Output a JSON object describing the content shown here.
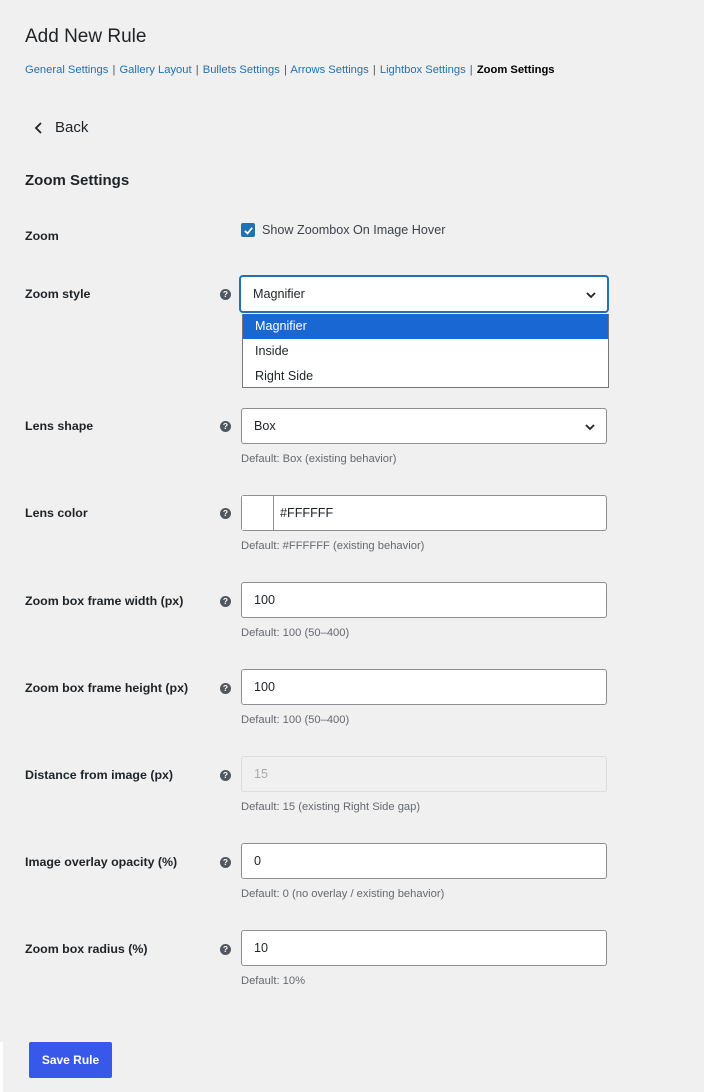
{
  "page": {
    "title": "Add New Rule"
  },
  "tabs": [
    {
      "label": "General Settings"
    },
    {
      "label": "Gallery Layout"
    },
    {
      "label": "Bullets Settings"
    },
    {
      "label": "Arrows Settings"
    },
    {
      "label": "Lightbox Settings"
    },
    {
      "label": "Zoom Settings",
      "current": true
    }
  ],
  "tab_separator": "|",
  "back": {
    "label": "Back"
  },
  "section": {
    "title": "Zoom Settings"
  },
  "help_glyph": "?",
  "fields": {
    "zoom": {
      "label": "Zoom",
      "checkbox_label": "Show Zoombox On Image Hover",
      "checked": true
    },
    "zoom_style": {
      "label": "Zoom style",
      "value": "Magnifier",
      "options": [
        "Magnifier",
        "Inside",
        "Right Side"
      ],
      "open": true
    },
    "lens_shape": {
      "label": "Lens shape",
      "value": "Box",
      "hint": "Default: Box (existing behavior)"
    },
    "lens_color": {
      "label": "Lens color",
      "value": "#FFFFFF",
      "swatch": "#FFFFFF",
      "hint": "Default: #FFFFFF (existing behavior)"
    },
    "frame_width": {
      "label": "Zoom box frame width (px)",
      "value": "100",
      "hint": "Default: 100 (50–400)"
    },
    "frame_height": {
      "label": "Zoom box frame height (px)",
      "value": "100",
      "hint": "Default: 100 (50–400)"
    },
    "distance": {
      "label": "Distance from image (px)",
      "value": "15",
      "disabled": true,
      "hint": "Default: 15 (existing Right Side gap)"
    },
    "overlay_opacity": {
      "label": "Image overlay opacity (%)",
      "value": "0",
      "hint": "Default: 0 (no overlay / existing behavior)"
    },
    "radius": {
      "label": "Zoom box radius (%)",
      "value": "10",
      "hint": "Default: 10%"
    }
  },
  "save": {
    "label": "Save Rule"
  },
  "colors": {
    "primary": "#2271b1",
    "button": "#3858e9",
    "option_highlight": "#1967d2"
  },
  "icons": [
    "chevron-left-icon",
    "check-icon",
    "help-icon",
    "chevron-down-icon"
  ]
}
